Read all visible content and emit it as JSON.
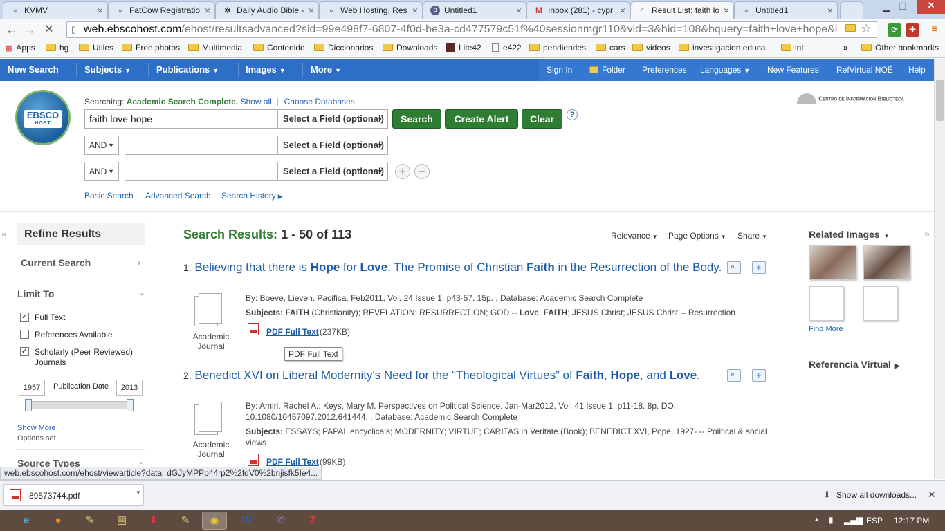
{
  "browser": {
    "tabs": [
      {
        "label": "KVMV",
        "icon": "page-icon"
      },
      {
        "label": "FatCow Registratio",
        "icon": "page-icon"
      },
      {
        "label": "Daily Audio Bible -",
        "icon": "dab-icon"
      },
      {
        "label": "Web Hosting, Res",
        "icon": "page-icon"
      },
      {
        "label": "Untitled1",
        "icon": "b-icon"
      },
      {
        "label": "Inbox (281) - cypr",
        "icon": "gmail-icon"
      },
      {
        "label": "Result List: faith lo",
        "icon": "loading-icon"
      },
      {
        "label": "Untitled1",
        "icon": "page-icon"
      }
    ],
    "url_host": "web.ebscohost.com",
    "url_path": "/ehost/resultsadvanced?sid=99e498f7-6807-4f0d-be3a-cd477579c51f%40sessionmgr110&vid=3&hid=108&bquery=faith+love+hope&l",
    "bookmarks": [
      "Apps",
      "hg",
      "Utiles",
      "Free photos",
      "Multimedia",
      "Contenido",
      "Diccionarios",
      "Downloads",
      "Lite42",
      "e422",
      "pendiendes",
      "cars",
      "videos",
      "investigacion educa...",
      "int"
    ],
    "bookmarks_more": "»",
    "other_bookmarks": "Other bookmarks"
  },
  "ebsco_nav": {
    "left": [
      "New Search",
      "Subjects",
      "Publications",
      "Images",
      "More"
    ],
    "right": [
      "Sign In",
      "Folder",
      "Preferences",
      "Languages",
      "New Features!",
      "RefVirtual NOÉ",
      "Help"
    ]
  },
  "search": {
    "searching_label": "Searching:",
    "database": "Academic Search Complete,",
    "show_all": "Show all",
    "choose_db": "Choose Databases",
    "query": "faith love hope",
    "field_placeholder": "Select a Field (optional)",
    "bool_op": "AND",
    "buttons": {
      "search": "Search",
      "create_alert": "Create Alert",
      "clear": "Clear"
    },
    "help": "?",
    "links": {
      "basic": "Basic Search",
      "advanced": "Advanced Search",
      "history": "Search History"
    },
    "org_logo": "Centro de Información Biblioteca"
  },
  "refine": {
    "title": "Refine Results",
    "current_search": "Current Search",
    "limit_to": "Limit To",
    "full_text": "Full Text",
    "references": "References Available",
    "scholarly": "Scholarly (Peer Reviewed) Journals",
    "pub_date_label": "Publication Date",
    "date_from": "1957",
    "date_to": "2013",
    "show_more": "Show More",
    "options_set": "Options set",
    "source_types": "Source Types"
  },
  "results": {
    "heading_label": "Search Results:",
    "heading_range": "1 - 50 of 113",
    "sort": "Relevance",
    "page_options": "Page Options",
    "share": "Share",
    "items": [
      {
        "num": "1.",
        "title_parts": [
          "Believing that there is ",
          "Hope",
          " for ",
          "Love",
          ": The Promise of Christian ",
          "Faith",
          " in the Resurrection of the Body."
        ],
        "byline": "By: Boeve, Lieven. Pacifica. Feb2011, Vol. 24 Issue 1, p43-57. 15p. , Database: Academic Search Complete",
        "subjects_label": "Subjects:",
        "subjects": [
          "FAITH",
          " (Christianity); REVELATION; RESURRECTION; GOD -- ",
          "Love",
          "; ",
          "FAITH",
          "; JESUS Christ; JESUS Christ -- Resurrection"
        ],
        "type": "Academic Journal",
        "pdf_label": "PDF Full Text",
        "pdf_size": "(237KB)",
        "tooltip": "PDF Full Text"
      },
      {
        "num": "2.",
        "title_parts": [
          "Benedict XVI on Liberal Modernity's Need for the “Theological Virtues” of ",
          "Faith",
          ", ",
          "Hope",
          ", and ",
          "Love",
          "."
        ],
        "byline": "By: Amiri, Rachel A.; Keys, Mary M. Perspectives on Political Science. Jan-Mar2012, Vol. 41 Issue 1, p11-18. 8p. DOI: 10.1080/10457097.2012.641444. , Database: Academic Search Complete",
        "subjects_label": "Subjects:",
        "subjects": [
          "ESSAYS; PAPAL encyclicals; MODERNITY; VIRTUE; CARITAS in Veritate (Book); BENEDICT XVI, Pope, 1927- -- Political & social views"
        ],
        "type": "Academic Journal",
        "pdf_label": "PDF Full Text",
        "pdf_size": "(99KB)"
      }
    ]
  },
  "right": {
    "related_images": "Related Images",
    "find_more": "Find More",
    "ref_virtual": "Referencia Virtual"
  },
  "status_url": "web.ebscohost.com/ehost/viewarticle?data=dGJyMPPp44rp2%2fdV0%2bnjisfk5Ie4...",
  "downloads": {
    "file": "89573744.pdf",
    "show_all": "Show all downloads..."
  },
  "taskbar": {
    "lang": "ESP",
    "time": "12:17 PM"
  }
}
